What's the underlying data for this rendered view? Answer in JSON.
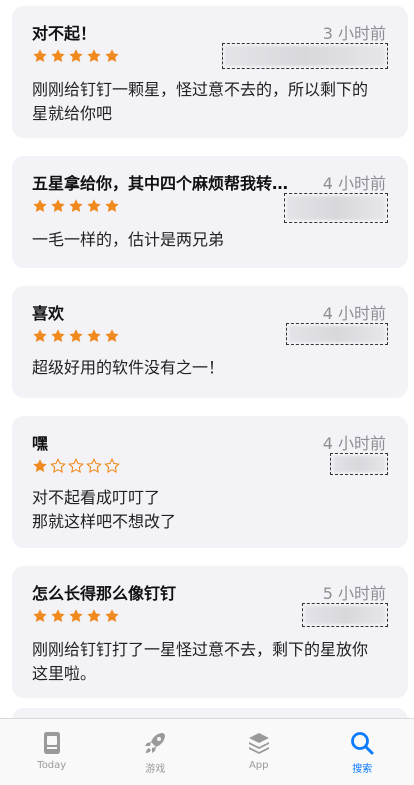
{
  "reviews": [
    {
      "title": "对不起！",
      "time": "3 小时前",
      "rating": 5,
      "body": "刚刚给钉钉一颗星，怪过意不去的，所以剩下的\n星就给你吧"
    },
    {
      "title": "五星拿给你，其中四个麻烦帮我转交…",
      "time": "4 小时前",
      "rating": 5,
      "body": "一毛一样的，估计是两兄弟"
    },
    {
      "title": "喜欢",
      "time": "4 小时前",
      "rating": 5,
      "body": "超级好用的软件没有之一！"
    },
    {
      "title": "嘿",
      "time": "4 小时前",
      "rating": 1,
      "body": "对不起看成叮叮了\n那就这样吧不想改了"
    },
    {
      "title": "怎么长得那么像钉钉",
      "time": "5 小时前",
      "rating": 5,
      "body": "刚刚给钉钉打了一星怪过意不去，剩下的星放你\n这里啦。"
    }
  ],
  "tabs": [
    {
      "label": "Today",
      "icon": "today-icon",
      "active": false
    },
    {
      "label": "游戏",
      "icon": "rocket-icon",
      "active": false
    },
    {
      "label": "App",
      "icon": "apps-stack-icon",
      "active": false
    },
    {
      "label": "搜索",
      "icon": "search-icon",
      "active": true
    }
  ],
  "colors": {
    "star": "#f0891e",
    "accent": "#0a7aff",
    "inactive": "#9a9a9a",
    "card": "#f2f2f7"
  }
}
